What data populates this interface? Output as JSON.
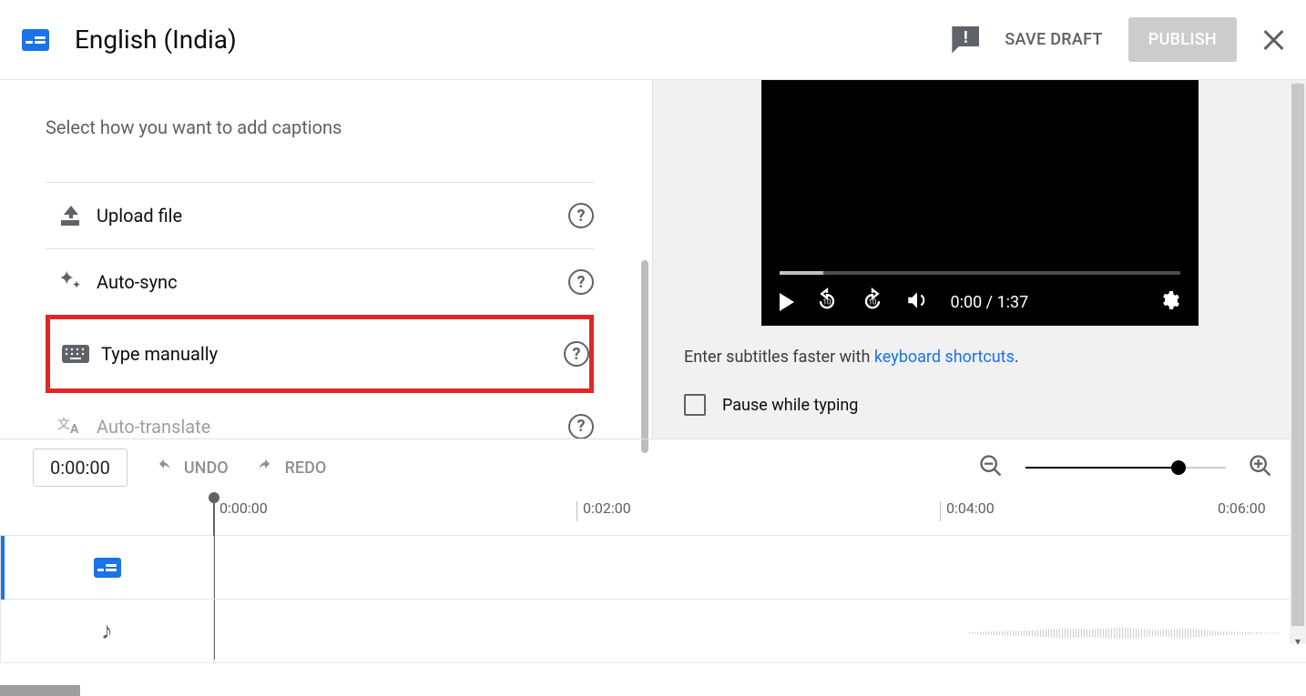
{
  "header": {
    "language_title": "English (India)",
    "save_draft": "SAVE DRAFT",
    "publish": "PUBLISH"
  },
  "left": {
    "prompt": "Select how you want to add captions",
    "options": [
      {
        "label": "Upload file",
        "icon": "upload-icon"
      },
      {
        "label": "Auto-sync",
        "icon": "sparkle-icon"
      },
      {
        "label": "Type manually",
        "icon": "keyboard-icon",
        "highlighted": true
      },
      {
        "label": "Auto-translate",
        "icon": "translate-icon",
        "disabled": true
      }
    ]
  },
  "video": {
    "current_time": "0:00",
    "duration": "1:37",
    "time_display": "0:00 / 1:37"
  },
  "tip": {
    "prefix": "Enter subtitles faster with ",
    "link": "keyboard shortcuts",
    "suffix": "."
  },
  "pause_while_typing": "Pause while typing",
  "timeline": {
    "current": "0:00:00",
    "undo": "UNDO",
    "redo": "REDO",
    "ticks": [
      "0:00:00",
      "0:02:00",
      "0:04:00",
      "0:06:00"
    ]
  }
}
